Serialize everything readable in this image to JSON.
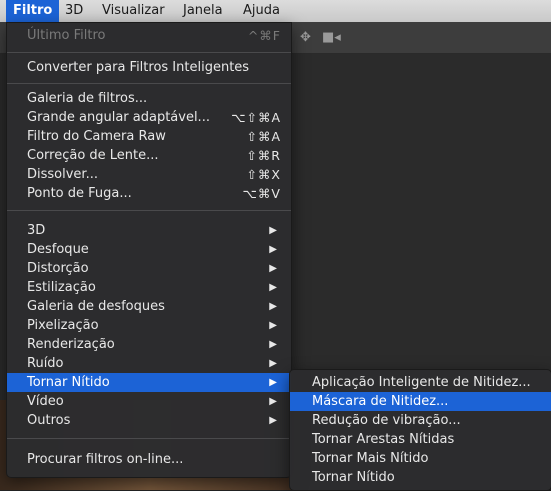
{
  "menubar": {
    "items": [
      "Filtro",
      "3D",
      "Visualizar",
      "Janela",
      "Ajuda"
    ]
  },
  "filter_menu": {
    "last_filter": {
      "label": "Último Filtro",
      "shortcut": "^⌘F"
    },
    "convert_smart": "Converter para Filtros Inteligentes",
    "gallery": "Galeria de filtros...",
    "wide_angle": {
      "label": "Grande angular adaptável...",
      "shortcut": "⌥⇧⌘A"
    },
    "camera_raw": {
      "label": "Filtro do Camera Raw",
      "shortcut": "⇧⌘A"
    },
    "lens_correction": {
      "label": "Correção de Lente...",
      "shortcut": "⇧⌘R"
    },
    "liquify": {
      "label": "Dissolver...",
      "shortcut": "⇧⌘X"
    },
    "vanishing_point": {
      "label": "Ponto de Fuga...",
      "shortcut": "⌥⌘V"
    },
    "submenus": [
      "3D",
      "Desfoque",
      "Distorção",
      "Estilização",
      "Galeria de desfoques",
      "Pixelização",
      "Renderização",
      "Ruído",
      "Tornar Nítido",
      "Vídeo",
      "Outros"
    ],
    "browse_online": "Procurar filtros on-line..."
  },
  "sharpen_submenu": {
    "items": [
      "Aplicação Inteligente de Nitidez...",
      "Máscara de Nitidez...",
      "Redução de vibração...",
      "Tornar Arestas Nítidas",
      "Tornar Mais Nítido",
      "Tornar Nítido"
    ]
  },
  "colors": {
    "highlight": "#1c63d6",
    "menu_bg": "#2c2c2e"
  }
}
